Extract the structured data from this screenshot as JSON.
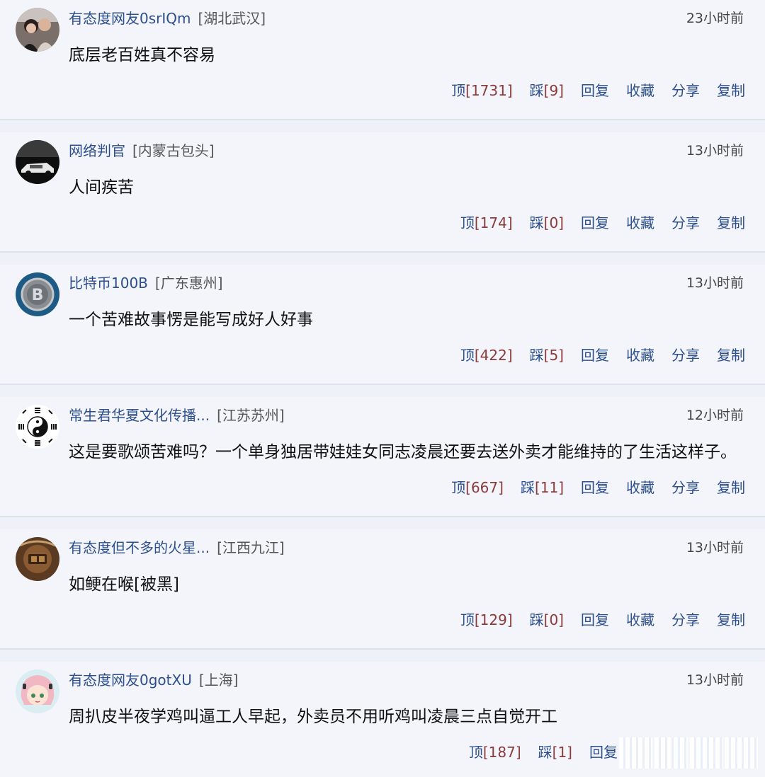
{
  "colors": {
    "background": "#f3f5fa",
    "username": "#2d4f8e",
    "action": "#2d4f8e",
    "count": "#8c3b3b"
  },
  "comments": [
    {
      "username": "有态度网友0srIQm",
      "location": "[湖北武汉]",
      "time": "23小时前",
      "content": "底层老百姓真不容易",
      "up": "顶[1731]",
      "down": "踩[9]",
      "reply": "回复",
      "collect": "收藏",
      "share": "分享",
      "copy": "复制",
      "avatar_icon": "couple-photo-avatar"
    },
    {
      "username": "网络判官",
      "location": "[内蒙古包头]",
      "time": "13小时前",
      "content": "人间疾苦",
      "up": "顶[174]",
      "down": "踩[0]",
      "reply": "回复",
      "collect": "收藏",
      "share": "分享",
      "copy": "复制",
      "avatar_icon": "car-photo-avatar"
    },
    {
      "username": "比特币100B",
      "location": "[广东惠州]",
      "time": "13小时前",
      "content": "一个苦难故事愣是能写成好人好事",
      "up": "顶[422]",
      "down": "踩[5]",
      "reply": "回复",
      "collect": "收藏",
      "share": "分享",
      "copy": "复制",
      "avatar_icon": "bitcoin-avatar"
    },
    {
      "username": "常生君华夏文化传播...",
      "location": "[江苏苏州]",
      "time": "12小时前",
      "content": "这是要歌颂苦难吗？一个单身独居带娃娃女同志凌晨还要去送外卖才能维持的了生活这样子。",
      "up": "顶[667]",
      "down": "踩[11]",
      "reply": "回复",
      "collect": "收藏",
      "share": "分享",
      "copy": "复制",
      "avatar_icon": "yin-yang-bagua-avatar"
    },
    {
      "username": "有态度但不多的火星...",
      "location": "[江西九江]",
      "time": "13小时前",
      "content": "如鲠在喉[被黑]",
      "up": "顶[129]",
      "down": "踩[0]",
      "reply": "回复",
      "collect": "收藏",
      "share": "分享",
      "copy": "复制",
      "avatar_icon": "brown-photo-avatar"
    },
    {
      "username": "有态度网友0gotXU",
      "location": "[上海]",
      "time": "13小时前",
      "content": "周扒皮半夜学鸡叫逼工人早起，外卖员不用听鸡叫凌晨三点自觉开工",
      "up": "顶[187]",
      "down": "踩[1]",
      "reply": "回复",
      "collect": "",
      "share": "",
      "copy": "",
      "avatar_icon": "anime-girl-avatar"
    }
  ]
}
